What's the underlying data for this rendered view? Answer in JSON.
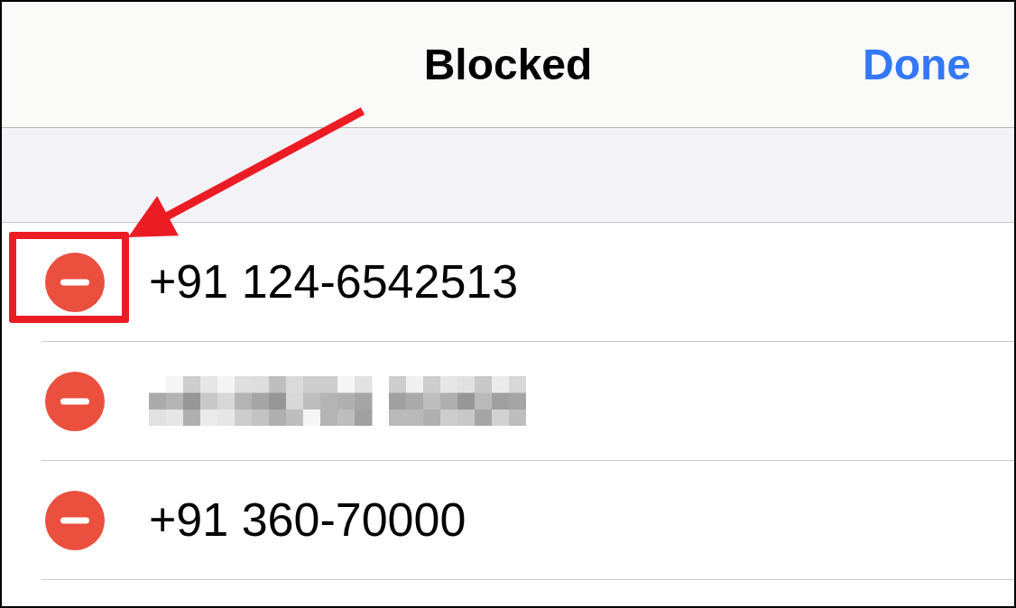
{
  "navigation_bar": {
    "title": "Blocked",
    "done_button": "Done"
  },
  "rows": [
    {
      "kind": "number",
      "number": "+91 124-6542513",
      "highlighted": true
    },
    {
      "kind": "redacted",
      "highlighted": false
    },
    {
      "kind": "number",
      "number": "+91 360-70000",
      "highlighted": false
    }
  ]
}
